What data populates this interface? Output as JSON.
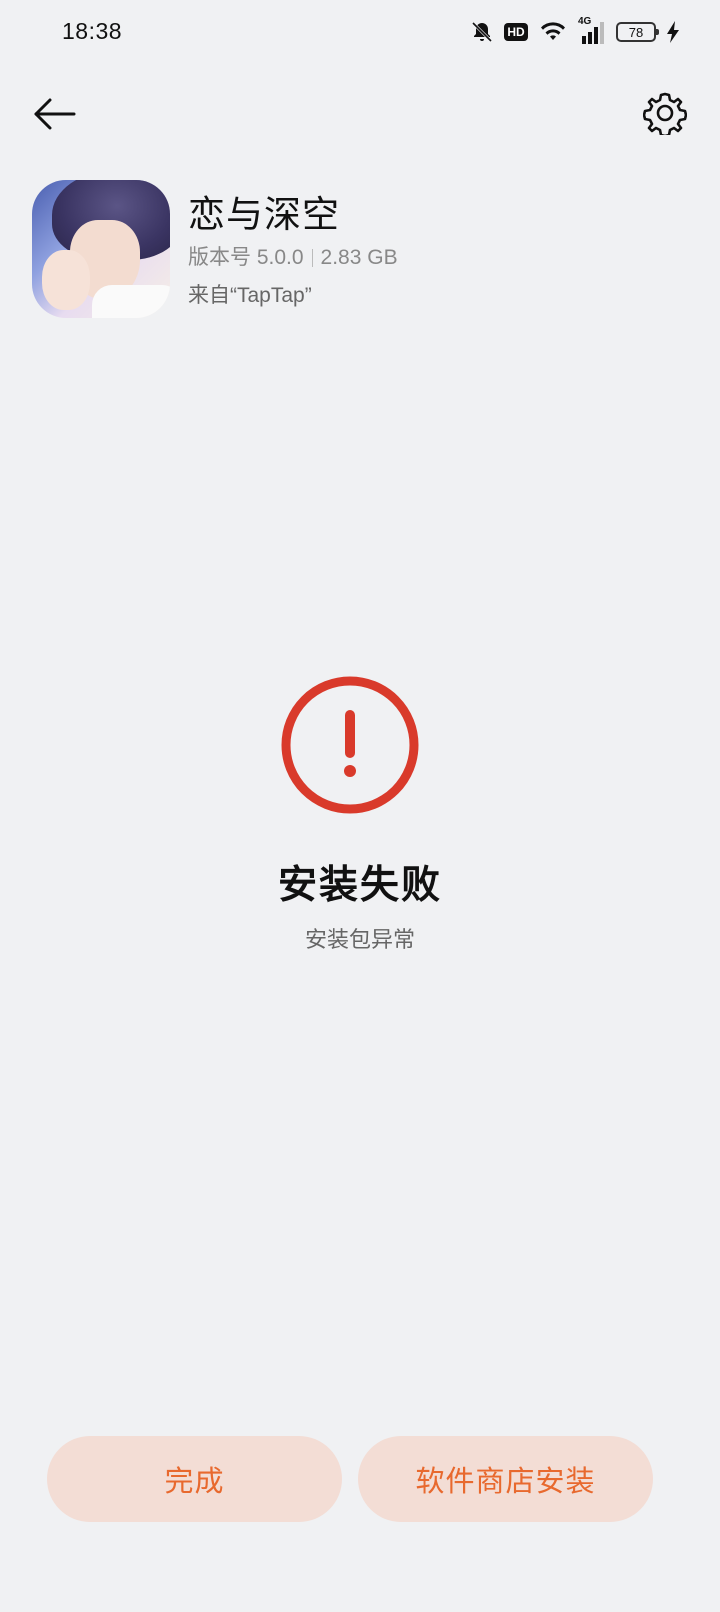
{
  "status_bar": {
    "time": "18:38",
    "hd_label": "HD",
    "network_label": "4G",
    "battery_level": "78",
    "icons": [
      "bell-muted-icon",
      "hd-icon",
      "wifi-icon",
      "signal-4g-icon",
      "battery-icon",
      "charging-icon"
    ]
  },
  "nav": {
    "back_icon": "arrow-left-icon",
    "settings_icon": "gear-icon"
  },
  "app": {
    "name": "恋与深空",
    "version_label": "版本号 5.0.0",
    "size": "2.83 GB",
    "source": "来自“TapTap”"
  },
  "result": {
    "icon": "exclamation-circle-icon",
    "title": "安装失败",
    "subtitle": "安装包异常",
    "accent_color": "#D93A2B"
  },
  "actions": {
    "done_label": "完成",
    "store_install_label": "软件商店安装",
    "button_text_color": "#E8692E",
    "button_bg_color": "#F3DDD5"
  }
}
